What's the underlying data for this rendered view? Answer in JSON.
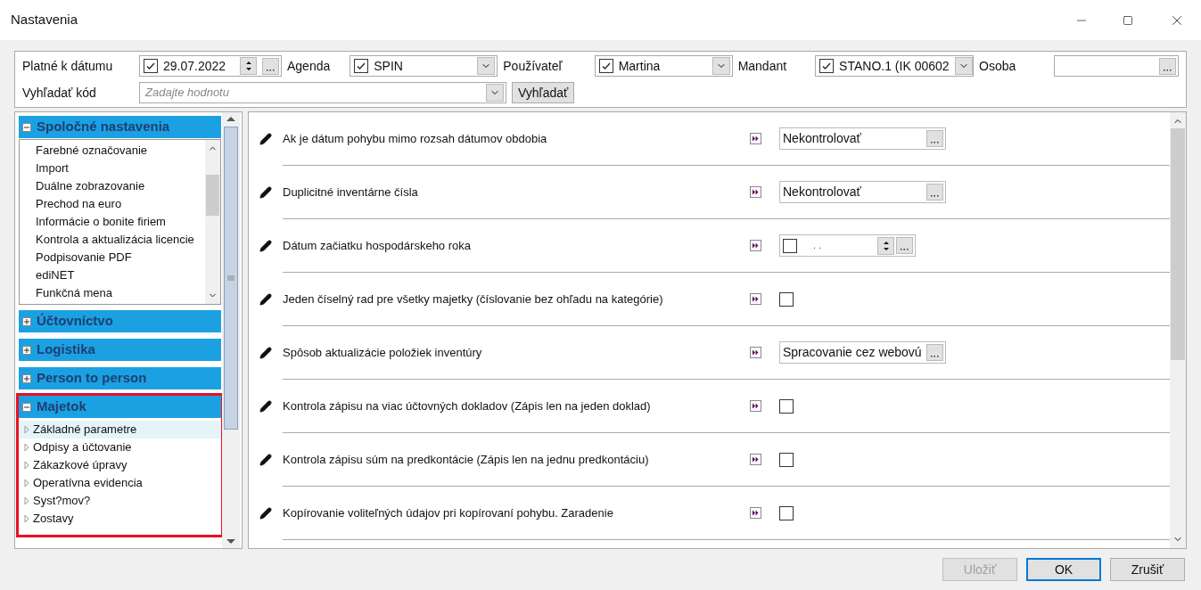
{
  "window": {
    "title": "Nastavenia"
  },
  "filters": {
    "date": {
      "label": "Platné k dátumu",
      "checked": true,
      "value": "29.07.2022"
    },
    "agenda": {
      "label": "Agenda",
      "checked": true,
      "value": "SPIN"
    },
    "user": {
      "label": "Používateľ",
      "checked": true,
      "value": "Martina"
    },
    "mandant": {
      "label": "Mandant",
      "checked": true,
      "value": "STANO.1 (IK 00602"
    },
    "person": {
      "label": "Osoba"
    },
    "search": {
      "label": "Vyhľadať kód",
      "placeholder": "Zadajte hodnotu",
      "button": "Vyhľadať"
    }
  },
  "sidebar": {
    "groups": [
      {
        "title": "Spoločné nastavenia",
        "expanded": true,
        "kind": "list",
        "items": [
          {
            "label": "Farebné označovanie",
            "selected": false
          },
          {
            "label": "Import",
            "selected": false
          },
          {
            "label": "Duálne zobrazovanie",
            "selected": false
          },
          {
            "label": "Prechod na euro",
            "selected": false
          },
          {
            "label": "Informácie o bonite firiem",
            "selected": false
          },
          {
            "label": "Kontrola a aktualizácia licencie",
            "selected": false
          },
          {
            "label": "Podpisovanie PDF",
            "selected": false
          },
          {
            "label": "ediNET",
            "selected": false
          },
          {
            "label": "Funkčná mena",
            "selected": false
          }
        ]
      },
      {
        "title": "Účtovníctvo",
        "expanded": false,
        "kind": "list"
      },
      {
        "title": "Logistika",
        "expanded": false,
        "kind": "list"
      },
      {
        "title": "Person to person",
        "expanded": false,
        "kind": "list"
      },
      {
        "title": "Majetok",
        "expanded": true,
        "highlighted": true,
        "kind": "tree",
        "items": [
          {
            "label": "Základné parametre",
            "selected": true
          },
          {
            "label": "Odpisy a účtovanie",
            "selected": false
          },
          {
            "label": "Zákazkové úpravy",
            "selected": false
          },
          {
            "label": "Operatívna evidencia",
            "selected": false
          },
          {
            "label": "Syst?mov?",
            "selected": false
          },
          {
            "label": "Zostavy",
            "selected": false
          }
        ]
      }
    ]
  },
  "settings": [
    {
      "label": "Ak je dátum pohybu mimo rozsah dátumov obdobia",
      "kind": "dropdown",
      "value": "Nekontrolovať"
    },
    {
      "label": "Duplicitné inventárne čísla",
      "kind": "dropdown",
      "value": "Nekontrolovať"
    },
    {
      "label": "Dátum začiatku hospodárskeho roka",
      "kind": "date",
      "checked": false,
      "value": ". ."
    },
    {
      "label": "Jeden číselný rad pre všetky majetky (číslovanie bez ohľadu na kategórie)",
      "kind": "checkbox",
      "checked": false
    },
    {
      "label": "Spôsob aktualizácie položiek inventúry",
      "kind": "dropdown",
      "value": "Spracovanie cez webovú"
    },
    {
      "label": "Kontrola zápisu  na viac účtovných dokladov (Zápis len na jeden doklad)",
      "kind": "checkbox",
      "checked": false
    },
    {
      "label": "Kontrola zápisu súm na predkontácie (Zápis len na jednu predkontáciu)",
      "kind": "checkbox",
      "checked": false
    },
    {
      "label": "Kopírovanie voliteľných údajov pri kopírovaní pohybu. Zaradenie",
      "kind": "checkbox",
      "checked": false
    }
  ],
  "buttons": [
    {
      "label": "Uložiť",
      "disabled": true,
      "default": false
    },
    {
      "label": "OK",
      "disabled": false,
      "default": true
    },
    {
      "label": "Zrušiť",
      "disabled": false,
      "default": false
    }
  ]
}
